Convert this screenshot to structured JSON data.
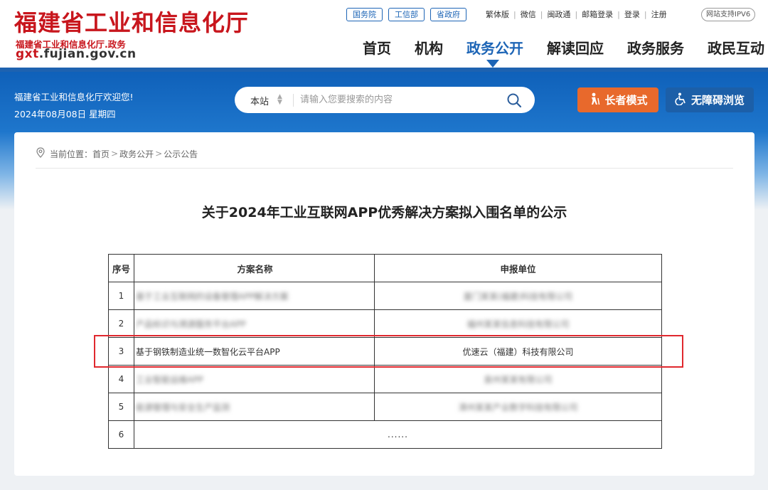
{
  "header": {
    "site_name": "福建省工业和信息化厅",
    "site_sub": "福建省工业和信息化厅.政务",
    "domain_red": "gxt",
    "domain_rest": ".fujian.gov.cn",
    "gov_links": [
      "国务院",
      "工信部",
      "省政府"
    ],
    "top_links": [
      "繁体版",
      "微信",
      "闽政通",
      "邮箱登录",
      "登录",
      "注册"
    ],
    "ipv6": "网站支持IPV6",
    "nav": [
      "首页",
      "机构",
      "政务公开",
      "解读回应",
      "政务服务",
      "政民互动"
    ],
    "active_nav": "政务公开"
  },
  "banner": {
    "welcome": "福建省工业和信息化厅欢迎您!",
    "date": "2024年08月08日 星期四",
    "search": {
      "scope": "本站",
      "placeholder": "请输入您要搜索的内容"
    },
    "elder_mode": "长者模式",
    "accessible": "无障碍浏览"
  },
  "breadcrumb": {
    "label": "当前位置：",
    "items": [
      "首页",
      "政务公开",
      "公示公告"
    ]
  },
  "article": {
    "title": "关于2024年工业互联网APP优秀解决方案拟入围名单的公示",
    "table": {
      "headers": [
        "序号",
        "方案名称",
        "申报单位"
      ],
      "rows": [
        {
          "no": "1",
          "name": "基于工业互联网的设备管理APP解决方案",
          "org": "厦门某某(福建)科技有限公司",
          "blurred": true
        },
        {
          "no": "2",
          "name": "产品标识与溯源服务平台APP",
          "org": "福州某某信息科技有限公司",
          "blurred": true
        },
        {
          "no": "3",
          "name": "基于钢铁制造业统一数智化云平台APP",
          "org": "优速云（福建）科技有限公司",
          "blurred": false
        },
        {
          "no": "4",
          "name": "工业智能运维APP",
          "org": "泉州某某有限公司",
          "blurred": true
        },
        {
          "no": "5",
          "name": "能源管理与安全生产监测",
          "org": "漳州某某产业数字科技有限公司",
          "blurred": true
        },
        {
          "no": "6",
          "name": "",
          "org": "......",
          "blurred": false
        }
      ]
    }
  },
  "colors": {
    "brand_red": "#c8161d",
    "nav_blue": "#1d65b6",
    "elder_orange": "#e8692c",
    "highlight_red": "#e0282e"
  }
}
